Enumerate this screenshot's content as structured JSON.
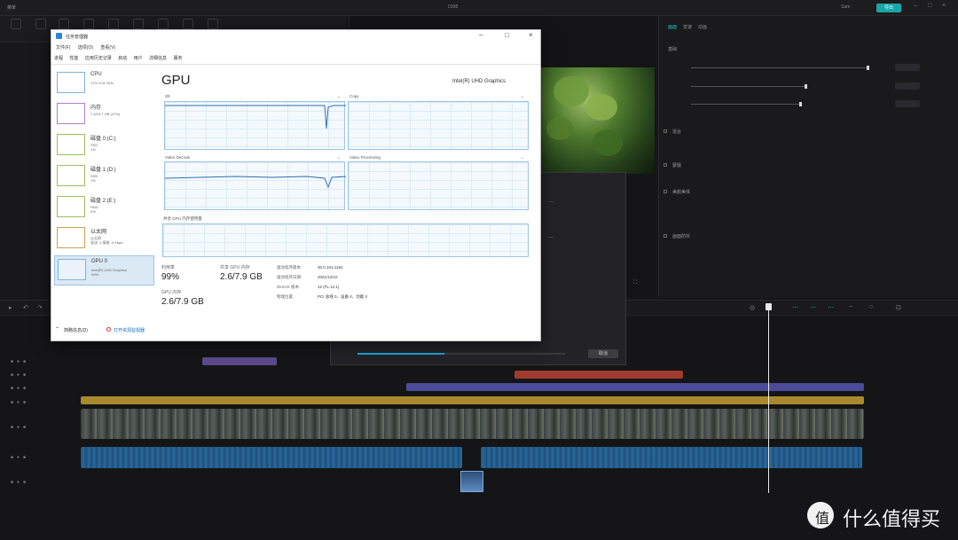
{
  "editor": {
    "menu_label": "菜单",
    "window_title": "0108",
    "account": "Sam",
    "export_label": "导出",
    "properties_tabs": [
      "画面",
      "变速",
      "动画"
    ],
    "properties_rows": [
      "基础",
      "混合",
      "蒙版",
      "美颜美体",
      "画面防抖"
    ],
    "dialog_button": "取消"
  },
  "task_manager": {
    "title": "任务管理器",
    "menu": [
      "文件(F)",
      "选项(O)",
      "查看(V)"
    ],
    "tabs": [
      "进程",
      "性能",
      "应用历史记录",
      "启动",
      "用户",
      "详细信息",
      "服务"
    ],
    "sidebar": [
      {
        "name": "CPU",
        "detail": "17% 3.01 GHz"
      },
      {
        "name": "内存",
        "detail": "7.4/15.7 GB (47%)"
      },
      {
        "name": "磁盘 0 (C:)",
        "detail": "SSD\n1%"
      },
      {
        "name": "磁盘 1 (D:)",
        "detail": "SSD\n1%"
      },
      {
        "name": "磁盘 2 (E:)",
        "detail": "HDD\n0%"
      },
      {
        "name": "以太网",
        "detail": "以太网\n发送: 0 接收: 0 Kbps"
      },
      {
        "name": "GPU 0",
        "detail": "Intel(R) UHD Graphics\n99%"
      }
    ],
    "gpu_heading": "GPU",
    "gpu_model": "Intel(R) UHD Graphics",
    "graph_labels": [
      "3D",
      "Copy",
      "Video Decode",
      "Video Processing"
    ],
    "shared_memory_label": "共享 GPU 内存使用量",
    "stats": {
      "utilization_label": "利用率",
      "utilization_value": "99%",
      "shared_mem_label": "共享 GPU 内存",
      "shared_mem_value": "2.6/7.9 GB",
      "gpu_mem_label": "GPU 内存",
      "gpu_mem_value": "2.6/7.9 GB"
    },
    "details": [
      {
        "k": "驱动程序版本:",
        "v": "30.0.101.1191"
      },
      {
        "k": "驱动程序日期:",
        "v": "2021/12/10"
      },
      {
        "k": "DirectX 版本:",
        "v": "12 (FL 12.1)"
      },
      {
        "k": "物理位置:",
        "v": "PCI 总线 0、设备 2、功能 0"
      }
    ],
    "footer_less": "简略信息(D)",
    "footer_resmon": "打开资源监视器"
  },
  "watermark": "什么值得买",
  "colors": {
    "accent": "#1aa6a6",
    "graph_line": "#2f6fb3",
    "graph_fill": "#d9e9f7"
  },
  "gpu_utilization": 0.99
}
